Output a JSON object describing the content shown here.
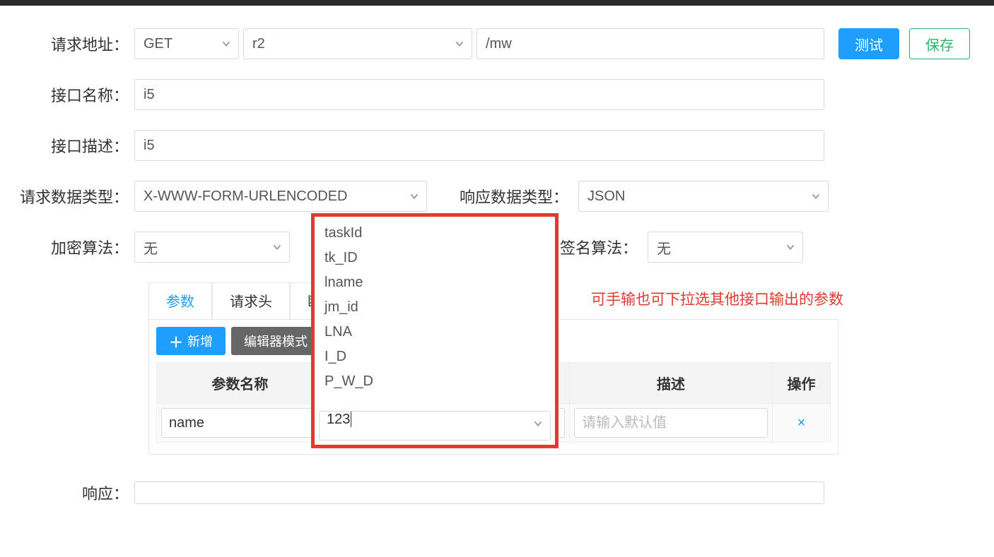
{
  "labels": {
    "request_url": "请求地址：",
    "interface_name": "接口名称：",
    "interface_desc": "接口描述：",
    "request_data_type": "请求数据类型：",
    "response_data_type": "响应数据类型：",
    "encryption_algo": "加密算法：",
    "signature_algo": "签名算法：",
    "response": "响应："
  },
  "url_row": {
    "method": "GET",
    "segment": "r2",
    "path": "/mw"
  },
  "interface": {
    "name": "i5",
    "desc": "i5"
  },
  "request_type": "X-WWW-FORM-URLENCODED",
  "response_type": "JSON",
  "encryption": "无",
  "signature": "无",
  "buttons": {
    "test": "测试",
    "save": "保存",
    "add": "新增",
    "editor_mode": "编辑器模式"
  },
  "tabs": {
    "params": "参数",
    "headers": "请求头",
    "assert": "断言"
  },
  "table": {
    "col_name": "参数名称",
    "col_desc": "描述",
    "col_ops": "操作",
    "row0_name": "name",
    "row0_value": "123",
    "desc_placeholder": "请输入默认值"
  },
  "dropdown": {
    "items": [
      "taskId",
      "tk_ID",
      "lname",
      "jm_id",
      "LNA",
      "I_D",
      "P_W_D"
    ],
    "input_value": "123"
  },
  "annotation": "可手输也可下拉选其他接口输出的参数"
}
